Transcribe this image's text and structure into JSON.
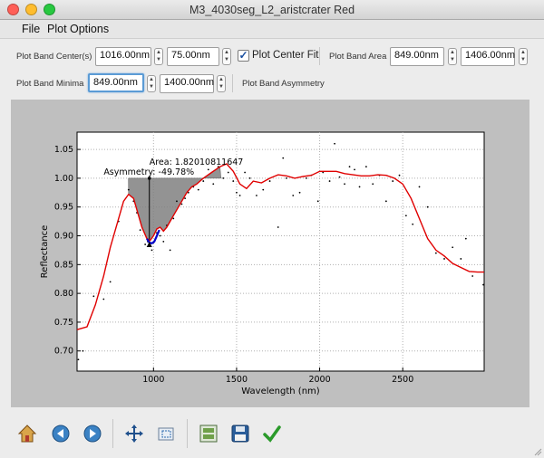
{
  "window": {
    "title": "M3_4030seg_L2_aristcrater Red"
  },
  "menu": {
    "file": "File",
    "plot_options": "Plot Options"
  },
  "controls": {
    "band_centers_label": "Plot Band Center(s)",
    "band_center_1": "1016.00nm",
    "band_center_2": "75.00nm",
    "center_fit_checked": true,
    "center_fit_label": "Plot Center Fit",
    "band_area_label": "Plot Band Area",
    "band_area_1": "849.00nm",
    "band_area_2": "1406.00nm",
    "band_minima_label": "Plot Band Minima",
    "band_minima_1": "849.00nm",
    "band_minima_2": "1400.00nm",
    "band_asymmetry_label": "Plot Band Asymmetry"
  },
  "toolbar": {
    "icons": [
      "home-icon",
      "back-icon",
      "forward-icon",
      "pan-icon",
      "zoom-icon",
      "configure-subplots-icon",
      "save-icon",
      "apply-icon"
    ]
  },
  "colors": {
    "fit_line": "#e00000",
    "points": "#000000",
    "band_fill": "#808080",
    "center_fit": "#0000cc",
    "plot_bg": "#bfbfbf"
  },
  "chart_data": {
    "type": "line",
    "xlabel": "Wavelength (nm)",
    "ylabel": "Reflectance",
    "xlim": [
      540,
      2990
    ],
    "ylim": [
      0.665,
      1.08
    ],
    "xticks": [
      1000,
      1500,
      2000,
      2500
    ],
    "yticks": [
      0.7,
      0.75,
      0.8,
      0.85,
      0.9,
      0.95,
      1.0,
      1.05
    ],
    "xtick_labels": [
      "1000",
      "1500",
      "2000",
      "2500"
    ],
    "ytick_labels": [
      "0.70",
      "0.75",
      "0.80",
      "0.85",
      "0.90",
      "0.95",
      "1.00",
      "1.05"
    ],
    "annotations": {
      "area": "Area: 1.82010811647",
      "asymmetry": "Asymmetry: -49.78%"
    },
    "series": [
      {
        "role": "smoothed-fit",
        "x": [
          540,
          600,
          650,
          700,
          740,
          780,
          820,
          850,
          880,
          900,
          930,
          960,
          980,
          1000,
          1020,
          1040,
          1060,
          1080,
          1100,
          1120,
          1150,
          1180,
          1200,
          1230,
          1260,
          1300,
          1350,
          1400,
          1440,
          1480,
          1520,
          1560,
          1600,
          1650,
          1700,
          1750,
          1800,
          1850,
          1900,
          1950,
          2000,
          2050,
          2100,
          2150,
          2200,
          2250,
          2300,
          2350,
          2400,
          2450,
          2500,
          2550,
          2600,
          2650,
          2700,
          2750,
          2800,
          2850,
          2900,
          2950,
          2990
        ],
        "y": [
          0.737,
          0.742,
          0.78,
          0.83,
          0.88,
          0.92,
          0.96,
          0.972,
          0.965,
          0.945,
          0.915,
          0.895,
          0.892,
          0.9,
          0.912,
          0.915,
          0.908,
          0.915,
          0.925,
          0.935,
          0.95,
          0.965,
          0.975,
          0.985,
          0.99,
          1.0,
          1.01,
          1.02,
          1.025,
          1.012,
          0.99,
          0.982,
          0.995,
          0.992,
          1.0,
          1.006,
          1.004,
          1.0,
          1.003,
          1.005,
          1.012,
          1.012,
          1.012,
          1.008,
          1.006,
          1.004,
          1.004,
          1.006,
          1.005,
          1.0,
          0.99,
          0.965,
          0.93,
          0.895,
          0.875,
          0.865,
          0.852,
          0.845,
          0.838,
          0.837,
          0.837
        ]
      },
      {
        "role": "raw-points",
        "x": [
          548,
          575,
          640,
          700,
          740,
          790,
          850,
          880,
          900,
          920,
          950,
          965,
          990,
          1000,
          1020,
          1040,
          1060,
          1080,
          1100,
          1120,
          1140,
          1170,
          1190,
          1210,
          1240,
          1270,
          1300,
          1330,
          1360,
          1390,
          1420,
          1450,
          1480,
          1500,
          1520,
          1550,
          1580,
          1620,
          1660,
          1700,
          1750,
          1780,
          1800,
          1840,
          1880,
          1920,
          1950,
          1990,
          2020,
          2060,
          2090,
          2120,
          2150,
          2180,
          2210,
          2240,
          2280,
          2320,
          2360,
          2400,
          2440,
          2480,
          2520,
          2560,
          2600,
          2650,
          2700,
          2750,
          2800,
          2850,
          2880,
          2920,
          2985
        ],
        "y": [
          0.685,
          0.7,
          0.795,
          0.79,
          0.82,
          0.925,
          0.98,
          0.96,
          0.94,
          0.91,
          0.885,
          0.89,
          0.875,
          0.888,
          0.905,
          0.9,
          0.89,
          0.918,
          0.875,
          0.93,
          0.96,
          0.955,
          0.965,
          0.975,
          0.985,
          0.98,
          0.995,
          1.015,
          0.99,
          1.02,
          1.0,
          1.01,
          0.995,
          0.975,
          0.97,
          1.01,
          1.0,
          0.97,
          0.98,
          0.995,
          0.915,
          1.035,
          1.0,
          0.97,
          0.975,
          1.0,
          1.005,
          0.96,
          1.01,
          0.995,
          1.06,
          1.002,
          0.99,
          1.02,
          1.015,
          0.985,
          1.02,
          0.99,
          1.005,
          0.96,
          0.995,
          1.005,
          0.935,
          0.92,
          0.985,
          0.95,
          0.87,
          0.86,
          0.88,
          0.86,
          0.895,
          0.83,
          0.815
        ]
      }
    ],
    "band_area": {
      "x_start": 849,
      "x_end": 1406,
      "continuum_y": 1.0
    },
    "band_minimum": {
      "x": 975,
      "y": 0.885
    },
    "band_center_fit": {
      "x": [
        960,
        975,
        990,
        1005,
        1020,
        1035
      ],
      "y": [
        0.895,
        0.888,
        0.887,
        0.89,
        0.9,
        0.91
      ]
    }
  }
}
